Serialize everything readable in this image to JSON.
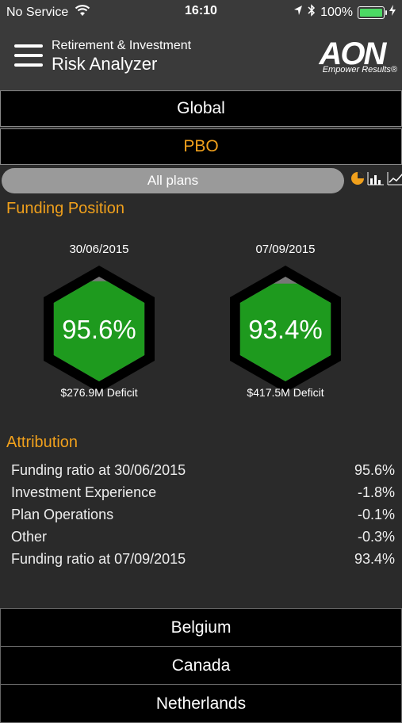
{
  "status_bar": {
    "carrier": "No Service",
    "time": "16:10",
    "battery_percent": "100%",
    "battery_level": 1.0
  },
  "header": {
    "subtitle": "Retirement & Investment",
    "title": "Risk Analyzer",
    "logo_text": "AON",
    "logo_tagline": "Empower Results®"
  },
  "region": "Global",
  "measure": "PBO",
  "plans": "All plans",
  "view_icons": [
    "gauge-icon",
    "bar-chart-icon",
    "line-chart-icon"
  ],
  "funding_position": {
    "title": "Funding Position",
    "items": [
      {
        "date": "30/06/2015",
        "value": "95.6%",
        "deficit": "$276.9M Deficit",
        "ratio": 0.956
      },
      {
        "date": "07/09/2015",
        "value": "93.4%",
        "deficit": "$417.5M Deficit",
        "ratio": 0.934
      }
    ]
  },
  "attribution": {
    "title": "Attribution",
    "rows": [
      {
        "label": "Funding ratio at 30/06/2015",
        "value": "95.6%"
      },
      {
        "label": "Investment Experience",
        "value": "-1.8%"
      },
      {
        "label": "Plan Operations",
        "value": "-0.1%"
      },
      {
        "label": "Other",
        "value": "-0.3%"
      },
      {
        "label": "Funding ratio at 07/09/2015",
        "value": "93.4%"
      }
    ]
  },
  "countries": [
    "Belgium",
    "Canada",
    "Netherlands"
  ],
  "colors": {
    "accent": "#f0a01c",
    "hex_fill": "#1e9a1e",
    "background": "#2a2a2a",
    "header": "#3a3a3a"
  }
}
